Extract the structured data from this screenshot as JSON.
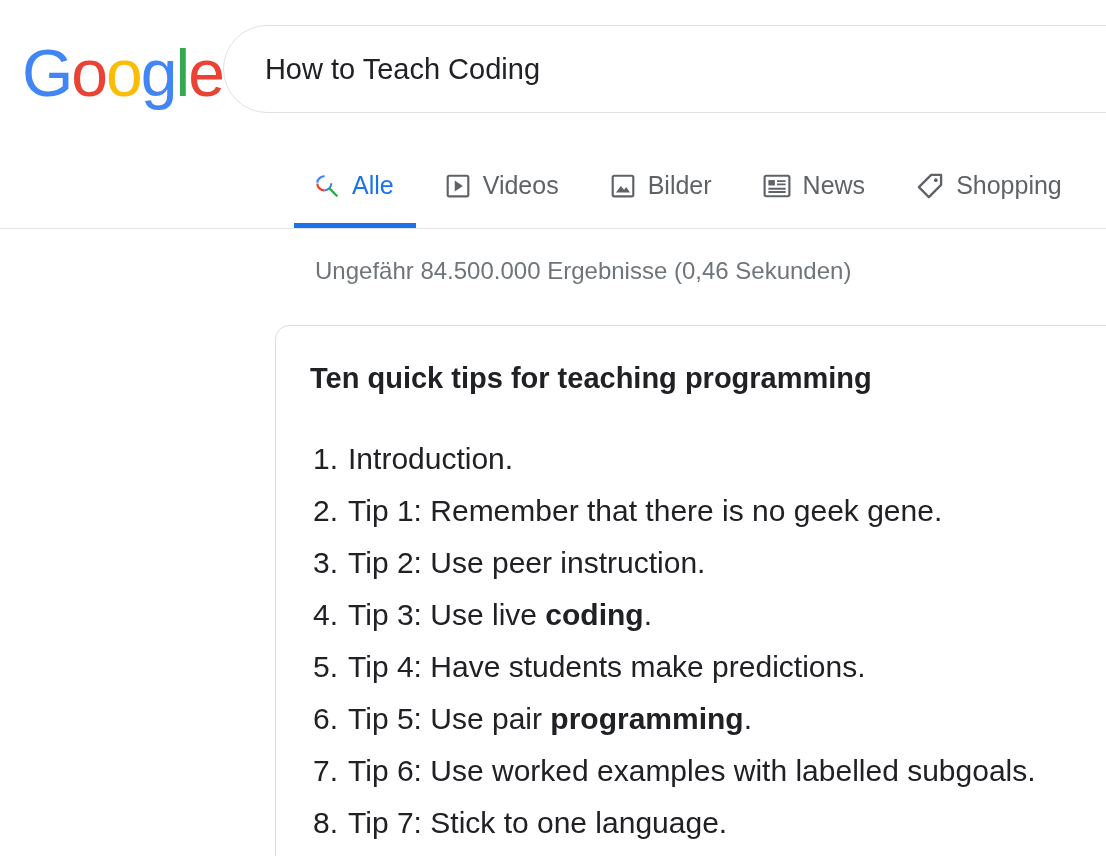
{
  "logo": "Google",
  "search": {
    "value": "How to Teach Coding"
  },
  "tabs": [
    {
      "label": "Alle",
      "kind": "search",
      "selected": true
    },
    {
      "label": "Videos",
      "kind": "video",
      "selected": false
    },
    {
      "label": "Bilder",
      "kind": "image",
      "selected": false
    },
    {
      "label": "News",
      "kind": "news",
      "selected": false
    },
    {
      "label": "Shopping",
      "kind": "tag",
      "selected": false
    }
  ],
  "result_stats": "Ungefähr 84.500.000 Ergebnisse (0,46 Sekunden)",
  "snippet": {
    "title": "Ten quick tips for teaching programming",
    "items": [
      {
        "number": "1.",
        "text": "Introduction."
      },
      {
        "number": "2.",
        "text": "Tip 1: Remember that there is no geek gene."
      },
      {
        "number": "3.",
        "text": "Tip 2: Use peer instruction."
      },
      {
        "number": "4.",
        "text": "Tip 3: Use live **coding**."
      },
      {
        "number": "5.",
        "text": "Tip 4: Have students make predictions."
      },
      {
        "number": "6.",
        "text": "Tip 5: Use pair **programming**."
      },
      {
        "number": "7.",
        "text": "Tip 6: Use worked examples with labelled subgoals."
      },
      {
        "number": "8.",
        "text": "Tip 7: Stick to one language."
      }
    ]
  }
}
